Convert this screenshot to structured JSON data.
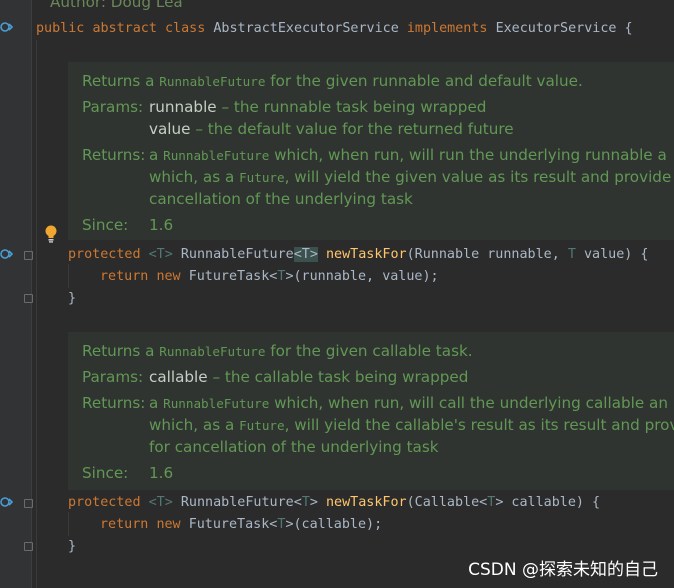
{
  "code": {
    "author_line": "Author: Doug Lea",
    "class_kw_public": "public",
    "class_kw_abstract": "abstract",
    "class_kw_class": "class",
    "class_name": "AbstractExecutorService",
    "class_kw_implements": "implements",
    "class_iface": "ExecutorService {",
    "m1_kw": "protected",
    "m1_tparam": "<T>",
    "m1_ret": "RunnableFuture",
    "m1_ret_tparam": "<T>",
    "m1_name": "newTaskFor",
    "m1_params_a": "(Runnable runnable,",
    "m1_params_b": "T",
    "m1_params_c": "value) {",
    "m1_body_return": "return",
    "m1_body_new": "new",
    "m1_body_rest_a": "FutureTask<",
    "m1_body_rest_b": "T",
    "m1_body_rest_c": ">(runnable,",
    "m1_body_rest_d": "value);",
    "close_brace": "}",
    "m2_kw": "protected",
    "m2_tparam": "<T>",
    "m2_ret": "RunnableFuture<",
    "m2_ret_t": "T",
    "m2_ret_close": ">",
    "m2_name": "newTaskFor",
    "m2_params_a": "(Callable<",
    "m2_params_b": "T",
    "m2_params_c": "> callable) {",
    "m2_body_return": "return",
    "m2_body_new": "new",
    "m2_body_rest_a": "FutureTask<",
    "m2_body_rest_b": "T",
    "m2_body_rest_c": ">(callable);"
  },
  "doc1": {
    "returns_prefix": "Returns a",
    "returns_mono": "RunnableFuture",
    "returns_suffix": "for the given runnable and default value.",
    "params_label": "Params:",
    "param1_name": "runnable",
    "param1_desc": "– the runnable task being wrapped",
    "param2_name": "value",
    "param2_desc": "– the default value for the returned future",
    "returns_label": "Returns:",
    "ret_line1_a": "a",
    "ret_line1_mono": "RunnableFuture",
    "ret_line1_b": "which, when run, will run the underlying runnable a",
    "ret_line2_a": "which, as a",
    "ret_line2_mono": "Future",
    "ret_line2_b": ", will yield the given value as its result and provide f",
    "ret_line3": "cancellation of the underlying task",
    "since_label": "Since:",
    "since_value": "1.6"
  },
  "doc2": {
    "returns_prefix": "Returns a",
    "returns_mono": "RunnableFuture",
    "returns_suffix": "for the given callable task.",
    "params_label": "Params:",
    "param1_name": "callable",
    "param1_desc": "– the callable task being wrapped",
    "returns_label": "Returns:",
    "ret_line1_a": "a",
    "ret_line1_mono": "RunnableFuture",
    "ret_line1_b": "which, when run, will call the underlying callable an",
    "ret_line2_a": "which, as a",
    "ret_line2_mono": "Future",
    "ret_line2_b": ", will yield the callable's result as its result and prov",
    "ret_line3": "for cancellation of the underlying task",
    "since_label": "Since:",
    "since_value": "1.6"
  },
  "watermark": "CSDN @探索未知的自己",
  "colors": {
    "background": "#2b2b2b",
    "keyword": "#cc7832",
    "method": "#ffc66d",
    "doc_text": "#629755",
    "identifier": "#a9b7c6"
  },
  "icons": [
    "implements-gutter-icon",
    "override-gutter-icon",
    "fold-icon",
    "lightbulb-icon"
  ]
}
